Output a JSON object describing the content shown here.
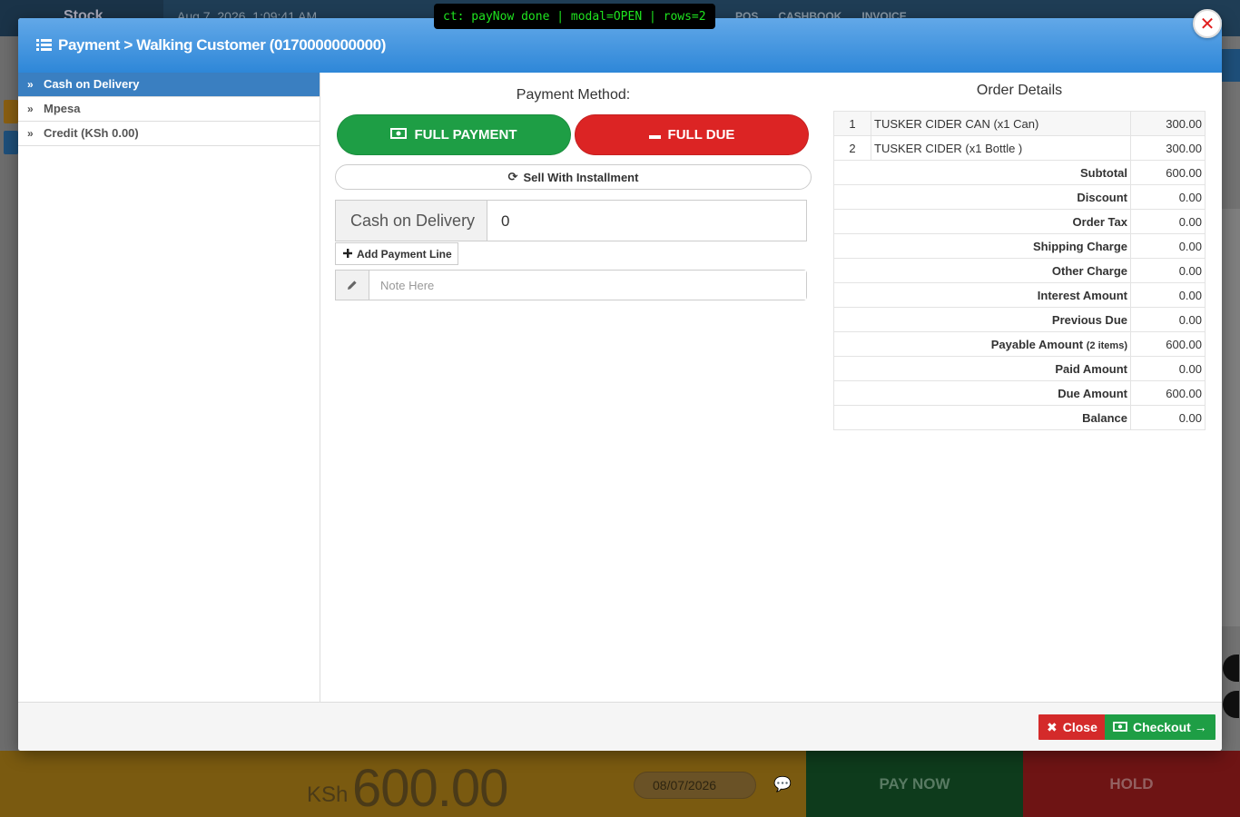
{
  "background": {
    "brand": "Stock",
    "datetime": "Aug 7, 2026, 1:09:41 AM",
    "nav": [
      "POS",
      "CASHBOOK",
      "INVOICE"
    ],
    "total_currency": "KSh",
    "total_amount": "600.00",
    "date_field": "08/07/2026",
    "pay_now": "PAY NOW",
    "hold": "HOLD"
  },
  "debug": "ct: payNow done | modal=OPEN | rows=2",
  "modal": {
    "title": "Payment > Walking Customer (0170000000000)",
    "sidebar": [
      {
        "label": "Cash on Delivery",
        "active": true
      },
      {
        "label": "Mpesa",
        "active": false
      },
      {
        "label": "Credit (KSh 0.00)",
        "active": false
      }
    ],
    "payment_method_title": "Payment Method:",
    "full_payment": "FULL PAYMENT",
    "full_due": "FULL DUE",
    "sell_installment": "Sell With Installment",
    "payment_line": {
      "method": "Cash on Delivery",
      "amount": "0"
    },
    "add_payment_line": "Add Payment Line",
    "note_placeholder": "Note Here",
    "order_title": "Order Details",
    "items": [
      {
        "num": "1",
        "name": "TUSKER CIDER CAN (x1 Can)",
        "amount": "300.00"
      },
      {
        "num": "2",
        "name": "TUSKER CIDER (x1 Bottle )",
        "amount": "300.00"
      }
    ],
    "summary": {
      "subtotal": {
        "label": "Subtotal",
        "value": "600.00"
      },
      "discount": {
        "label": "Discount",
        "value": "0.00"
      },
      "order_tax": {
        "label": "Order Tax",
        "value": "0.00"
      },
      "shipping": {
        "label": "Shipping Charge",
        "value": "0.00"
      },
      "other": {
        "label": "Other Charge",
        "value": "0.00"
      },
      "interest": {
        "label": "Interest Amount",
        "value": "0.00"
      },
      "previous_due": {
        "label": "Previous Due",
        "value": "0.00"
      },
      "payable": {
        "label": "Payable Amount",
        "note": "(2 items)",
        "value": "600.00"
      },
      "paid": {
        "label": "Paid Amount",
        "value": "0.00"
      },
      "due": {
        "label": "Due Amount",
        "value": "600.00"
      },
      "balance": {
        "label": "Balance",
        "value": "0.00"
      }
    },
    "close_btn": "Close",
    "checkout_btn": "Checkout →"
  },
  "colors": {
    "header_blue": "#2e87d8",
    "active_blue": "#3a7fc1",
    "green": "#1e9e45",
    "red": "#dc2424"
  }
}
